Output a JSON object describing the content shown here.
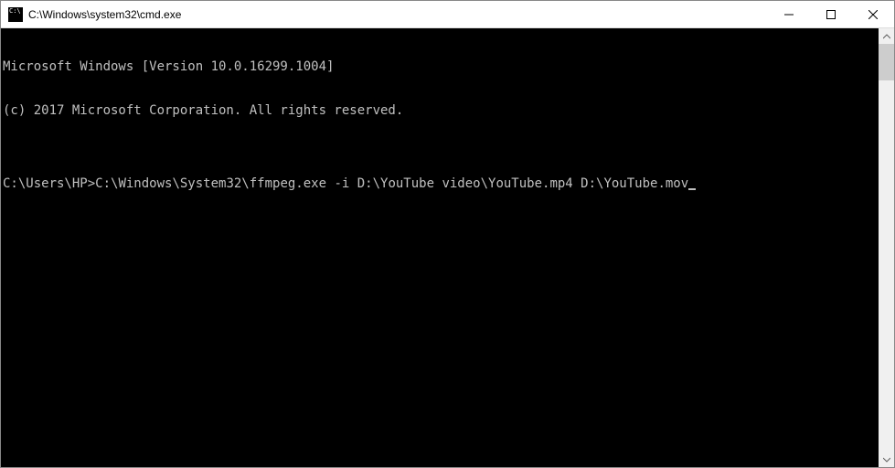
{
  "window": {
    "title": "C:\\Windows\\system32\\cmd.exe"
  },
  "console": {
    "line1": "Microsoft Windows [Version 10.0.16299.1004]",
    "line2": "(c) 2017 Microsoft Corporation. All rights reserved.",
    "blank": "",
    "prompt": "C:\\Users\\HP>",
    "command": "C:\\Windows\\System32\\ffmpeg.exe -i D:\\YouTube video\\YouTube.mp4 D:\\YouTube.mov"
  }
}
